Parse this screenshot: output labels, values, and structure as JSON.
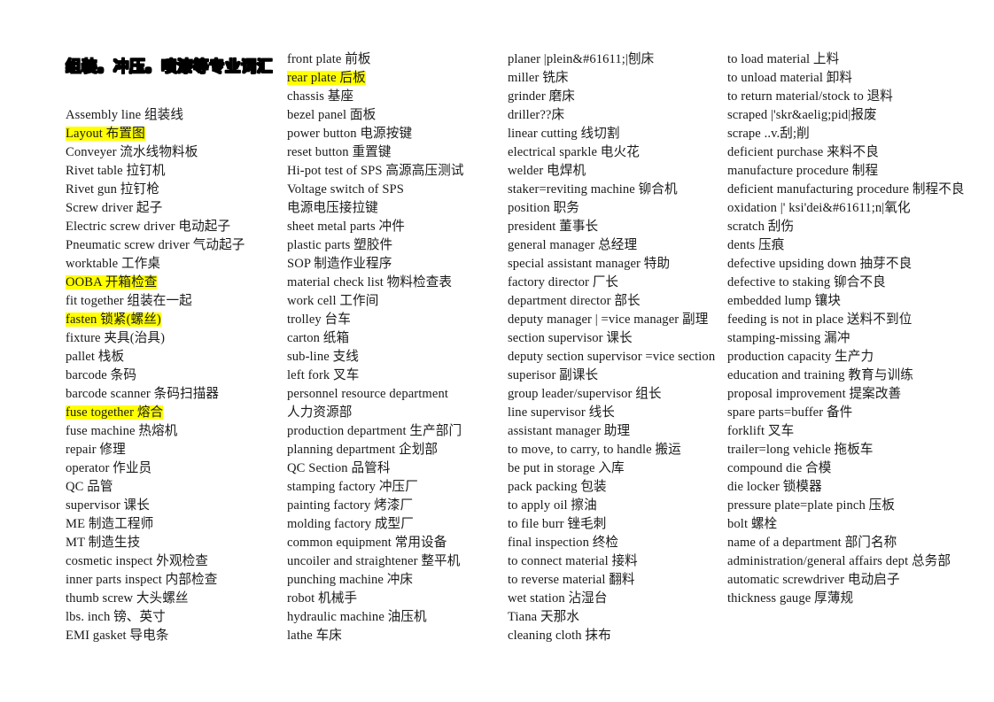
{
  "document": {
    "title": "组装。冲压。喷漆等专业词汇",
    "highlight_color": "#ffff00",
    "text_color": "#1a1a1a",
    "background_color": "#ffffff"
  },
  "columns": [
    {
      "name": "column-1",
      "entries": [
        {
          "text": "Assembly line 组装线",
          "highlight": false
        },
        {
          "text": "Layout 布置图",
          "highlight": true
        },
        {
          "text": "Conveyer 流水线物料板",
          "highlight": false
        },
        {
          "text": "Rivet table 拉钉机",
          "highlight": false
        },
        {
          "text": "Rivet gun 拉钉枪",
          "highlight": false
        },
        {
          "text": "Screw driver 起子",
          "highlight": false
        },
        {
          "text": "Electric screw driver 电动起子",
          "highlight": false
        },
        {
          "text": "Pneumatic screw driver 气动起子",
          "highlight": false
        },
        {
          "text": "worktable  工作桌",
          "highlight": false
        },
        {
          "text": "OOBA 开箱检查",
          "highlight": true
        },
        {
          "text": "fit together 组装在一起",
          "highlight": false
        },
        {
          "text": "fasten 锁紧(螺丝)",
          "highlight": true
        },
        {
          "text": "fixture  夹具(治具)",
          "highlight": false
        },
        {
          "text": "pallet 栈板",
          "highlight": false
        },
        {
          "text": "barcode 条码",
          "highlight": false
        },
        {
          "text": "barcode scanner 条码扫描器",
          "highlight": false
        },
        {
          "text": "fuse together 熔合",
          "highlight": true
        },
        {
          "text": "fuse machine 热熔机",
          "highlight": false
        },
        {
          "text": "repair 修理",
          "highlight": false
        },
        {
          "text": "operator 作业员",
          "highlight": false
        },
        {
          "text": "QC 品管",
          "highlight": false
        },
        {
          "text": "supervisor  课长",
          "highlight": false
        },
        {
          "text": "ME 制造工程师",
          "highlight": false
        },
        {
          "text": "MT 制造生技",
          "highlight": false
        },
        {
          "text": "cosmetic inspect 外观检查",
          "highlight": false
        },
        {
          "text": "inner parts inspect 内部检查",
          "highlight": false
        },
        {
          "text": "thumb screw 大头螺丝",
          "highlight": false
        },
        {
          "text": "lbs. inch 镑、英寸",
          "highlight": false
        },
        {
          "text": "EMI gasket 导电条",
          "highlight": false
        }
      ]
    },
    {
      "name": "column-2",
      "entries": [
        {
          "text": "front plate 前板",
          "highlight": false
        },
        {
          "text": "rear plate 后板",
          "highlight": true
        },
        {
          "text": "chassis    基座",
          "highlight": false
        },
        {
          "text": "bezel panel 面板",
          "highlight": false
        },
        {
          "text": "power button 电源按键",
          "highlight": false
        },
        {
          "text": "reset button 重置键",
          "highlight": false
        },
        {
          "text": "Hi-pot test of SPS 高源高压测试",
          "highlight": false
        },
        {
          "text": "Voltage switch of SPS",
          "highlight": false
        },
        {
          "text": "电源电压接拉键",
          "highlight": false
        },
        {
          "text": "sheet metal parts 冲件",
          "highlight": false
        },
        {
          "text": "plastic parts 塑胶件",
          "highlight": false
        },
        {
          "text": "SOP 制造作业程序",
          "highlight": false
        },
        {
          "text": "material check list 物料检查表",
          "highlight": false
        },
        {
          "text": "work cell 工作间",
          "highlight": false
        },
        {
          "text": "trolley 台车",
          "highlight": false
        },
        {
          "text": "carton 纸箱",
          "highlight": false
        },
        {
          "text": "sub-line 支线",
          "highlight": false
        },
        {
          "text": "left fork 叉车",
          "highlight": false
        },
        {
          "text": "personnel resource department",
          "highlight": false
        },
        {
          "text": "人力资源部",
          "highlight": false
        },
        {
          "text": "production department 生产部门",
          "highlight": false
        },
        {
          "text": "planning department 企划部",
          "highlight": false
        },
        {
          "text": "QC Section 品管科",
          "highlight": false
        },
        {
          "text": "stamping factory 冲压厂",
          "highlight": false
        },
        {
          "text": "painting factory 烤漆厂",
          "highlight": false
        },
        {
          "text": "molding factory 成型厂",
          "highlight": false
        },
        {
          "text": "common equipment 常用设备",
          "highlight": false
        },
        {
          "text": "uncoiler and straightener 整平机",
          "highlight": false
        },
        {
          "text": "punching machine 冲床",
          "highlight": false
        },
        {
          "text": "robot 机械手",
          "highlight": false
        },
        {
          "text": "hydraulic machine 油压机",
          "highlight": false
        },
        {
          "text": "lathe 车床",
          "highlight": false
        }
      ]
    },
    {
      "name": "column-3",
      "entries": [
        {
          "text": "planer |plein&#61611;|刨床",
          "highlight": false
        },
        {
          "text": "miller 铣床",
          "highlight": false
        },
        {
          "text": "grinder 磨床",
          "highlight": false
        },
        {
          "text": "driller??床",
          "highlight": false
        },
        {
          "text": "linear cutting 线切割",
          "highlight": false
        },
        {
          "text": "electrical sparkle 电火花",
          "highlight": false
        },
        {
          "text": "welder 电焊机",
          "highlight": false
        },
        {
          "text": "staker=reviting machine 铆合机",
          "highlight": false
        },
        {
          "text": "position 职务",
          "highlight": false
        },
        {
          "text": "president 董事长",
          "highlight": false
        },
        {
          "text": "general manager 总经理",
          "highlight": false
        },
        {
          "text": "special assistant manager 特助",
          "highlight": false
        },
        {
          "text": "factory director 厂长",
          "highlight": false
        },
        {
          "text": "department director 部长",
          "highlight": false
        },
        {
          "text": "deputy manager | =vice manager 副理",
          "highlight": false
        },
        {
          "text": "section supervisor 课长",
          "highlight": false
        },
        {
          "text": "deputy section supervisor =vice section",
          "highlight": false
        },
        {
          "text": "superisor 副课长",
          "highlight": false
        },
        {
          "text": "group leader/supervisor 组长",
          "highlight": false
        },
        {
          "text": "line supervisor 线长",
          "highlight": false
        },
        {
          "text": "assistant manager 助理",
          "highlight": false
        },
        {
          "text": "to move, to carry, to handle 搬运",
          "highlight": false
        },
        {
          "text": "be put in storage 入库",
          "highlight": false
        },
        {
          "text": "pack packing 包装",
          "highlight": false
        },
        {
          "text": "to apply oil 擦油",
          "highlight": false
        },
        {
          "text": "to file burr  锉毛刺",
          "highlight": false
        },
        {
          "text": "final inspection 终检",
          "highlight": false
        },
        {
          "text": "to connect material 接料",
          "highlight": false
        },
        {
          "text": "to reverse material  翻料",
          "highlight": false
        },
        {
          "text": "wet station 沾湿台",
          "highlight": false
        },
        {
          "text": "Tiana 天那水",
          "highlight": false
        },
        {
          "text": "cleaning cloth 抹布",
          "highlight": false
        }
      ]
    },
    {
      "name": "column-4",
      "entries": [
        {
          "text": "to load material 上料",
          "highlight": false,
          "justify": false
        },
        {
          "text": "to unload material 卸料",
          "highlight": false,
          "justify": false
        },
        {
          "text": "to return material/stock to 退料",
          "highlight": false,
          "justify": false
        },
        {
          "text": "scraped |'skr&aelig;pid|报废",
          "highlight": false,
          "justify": false
        },
        {
          "text": "scrape ..v.刮;削",
          "highlight": false,
          "justify": false
        },
        {
          "text": "deficient purchase 来料不良",
          "highlight": false,
          "justify": false
        },
        {
          "text": "manufacture procedure 制程",
          "highlight": false,
          "justify": false
        },
        {
          "text": "deficient manufacturing procedure 制程不良",
          "highlight": false,
          "justify": true
        },
        {
          "text": "oxidation |' ksi'dei&#61611;n|氧化",
          "highlight": false,
          "justify": false
        },
        {
          "text": "scratch 刮伤",
          "highlight": false,
          "justify": false
        },
        {
          "text": "dents 压痕",
          "highlight": false,
          "justify": false
        },
        {
          "text": "defective upsiding down 抽芽不良",
          "highlight": false,
          "justify": false
        },
        {
          "text": "defective to staking 铆合不良",
          "highlight": false,
          "justify": false
        },
        {
          "text": "embedded lump 镶块",
          "highlight": false,
          "justify": false
        },
        {
          "text": "feeding is not in place 送料不到位",
          "highlight": false,
          "justify": false
        },
        {
          "text": "stamping-missing 漏冲",
          "highlight": false,
          "justify": false
        },
        {
          "text": "production capacity 生产力",
          "highlight": false,
          "justify": false
        },
        {
          "text": "education and training 教育与训练",
          "highlight": false,
          "justify": false
        },
        {
          "text": "proposal improvement 提案改善",
          "highlight": false,
          "justify": false
        },
        {
          "text": "spare parts=buffer 备件",
          "highlight": false,
          "justify": false
        },
        {
          "text": "forklift 叉车",
          "highlight": false,
          "justify": false
        },
        {
          "text": "trailer=long vehicle 拖板车",
          "highlight": false,
          "justify": false
        },
        {
          "text": "compound die 合模",
          "highlight": false,
          "justify": false
        },
        {
          "text": "die locker 锁模器",
          "highlight": false,
          "justify": false
        },
        {
          "text": "pressure plate=plate pinch 压板",
          "highlight": false,
          "justify": false
        },
        {
          "text": "bolt 螺栓",
          "highlight": false,
          "justify": false
        },
        {
          "text": "name of a department 部门名称",
          "highlight": false,
          "justify": false
        },
        {
          "text": "administration/general affairs dept 总务部",
          "highlight": false,
          "justify": true
        },
        {
          "text": "automatic screwdriver 电动启子",
          "highlight": false,
          "justify": false
        },
        {
          "text": "thickness gauge 厚薄规",
          "highlight": false,
          "justify": false
        }
      ]
    }
  ]
}
